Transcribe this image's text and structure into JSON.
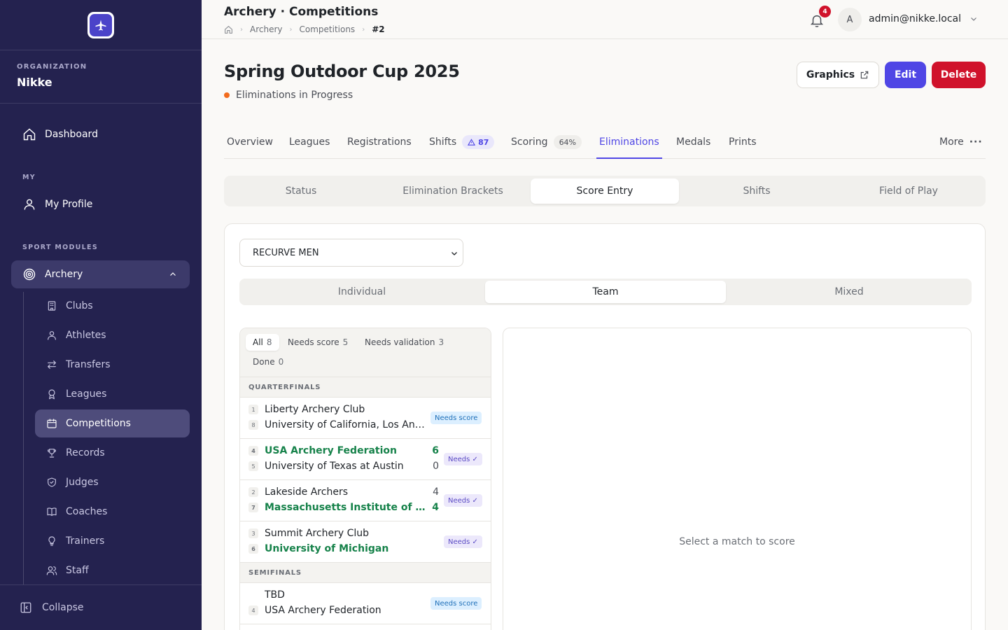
{
  "sidebar": {
    "org_caption": "ORGANIZATION",
    "org_name": "Nikke",
    "dashboard": "Dashboard",
    "my_caption": "MY",
    "my_profile": "My Profile",
    "modules_caption": "SPORT MODULES",
    "archery": "Archery",
    "sub_items": [
      "Clubs",
      "Athletes",
      "Transfers",
      "Leagues",
      "Competitions",
      "Records",
      "Judges",
      "Coaches",
      "Trainers",
      "Staff"
    ],
    "sub_icons": [
      "building-icon",
      "user-icon",
      "transfer-icon",
      "award-icon",
      "calendar-icon",
      "trophy-icon",
      "shield-icon",
      "book-icon",
      "lightbulb-icon",
      "users-icon"
    ],
    "active_item": "Competitions",
    "collapse": "Collapse"
  },
  "header": {
    "title": "Archery · Competitions",
    "crumbs": [
      "Archery",
      "Competitions",
      "#2"
    ],
    "notifications": "4",
    "avatar_initial": "A",
    "user_email": "admin@nikke.local"
  },
  "page": {
    "title": "Spring Outdoor Cup 2025",
    "status": "Eliminations in Progress",
    "status_color": "#f26b1d",
    "graphics_button": "Graphics",
    "edit_button": "Edit",
    "delete_button": "Delete"
  },
  "tabs": {
    "overview": "Overview",
    "leagues": "Leagues",
    "registrations": "Registrations",
    "shifts": "Shifts",
    "shifts_badge": "87",
    "scoring": "Scoring",
    "scoring_badge": "64%",
    "eliminations": "Eliminations",
    "medals": "Medals",
    "prints": "Prints",
    "more": "More"
  },
  "subtabs": [
    "Status",
    "Elimination Brackets",
    "Score Entry",
    "Shifts",
    "Field of Play"
  ],
  "score_entry": {
    "division": "RECURVE MEN",
    "segments": [
      "Individual",
      "Team",
      "Mixed"
    ],
    "filters": [
      {
        "label": "All",
        "count": "8"
      },
      {
        "label": "Needs score",
        "count": "5"
      },
      {
        "label": "Needs validation",
        "count": "3"
      },
      {
        "label": "Done",
        "count": "0"
      }
    ],
    "rounds": [
      {
        "name": "QUARTERFINALS",
        "matches": [
          {
            "a": {
              "seed": "1",
              "name": "Liberty Archery Club",
              "score": "",
              "win": false
            },
            "b": {
              "seed": "8",
              "name": "University of California, Los Angeles",
              "score": "",
              "win": false
            },
            "status": "Needs score",
            "kind": "score"
          },
          {
            "a": {
              "seed": "4",
              "name": "USA Archery Federation",
              "score": "6",
              "win": true
            },
            "b": {
              "seed": "5",
              "name": "University of Texas at Austin",
              "score": "0",
              "win": false
            },
            "status": "Needs ✓",
            "kind": "validate"
          },
          {
            "a": {
              "seed": "2",
              "name": "Lakeside Archers",
              "score": "4",
              "win": false
            },
            "b": {
              "seed": "7",
              "name": "Massachusetts Institute of Technology",
              "score": "4",
              "win": true
            },
            "status": "Needs ✓",
            "kind": "validate"
          },
          {
            "a": {
              "seed": "3",
              "name": "Summit Archery Club",
              "score": "",
              "win": false
            },
            "b": {
              "seed": "6",
              "name": "University of Michigan",
              "score": "",
              "win": true
            },
            "status": "Needs ✓",
            "kind": "validate"
          }
        ]
      },
      {
        "name": "SEMIFINALS",
        "matches": [
          {
            "a": {
              "seed": "",
              "name": "TBD",
              "score": "",
              "win": false
            },
            "b": {
              "seed": "4",
              "name": "USA Archery Federation",
              "score": "",
              "win": false
            },
            "status": "Needs score",
            "kind": "score"
          }
        ]
      }
    ],
    "empty_message": "Select a match to score"
  }
}
